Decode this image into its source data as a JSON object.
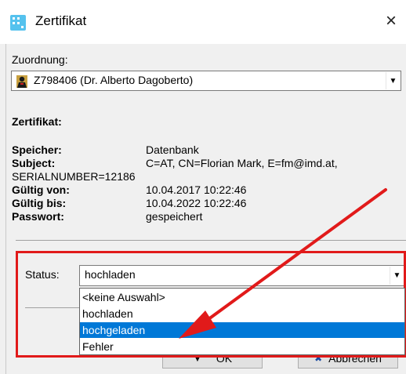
{
  "window": {
    "title": "Zertifikat",
    "close_symbol": "×"
  },
  "assignment": {
    "label": "Zuordnung:",
    "value": "Z798406 (Dr. Alberto Dagoberto)"
  },
  "certificate": {
    "heading": "Zertifikat:",
    "fields": {
      "speicher_label": "Speicher:",
      "speicher_value": "Datenbank",
      "subject_label": "Subject:",
      "subject_value": "C=AT, CN=Florian Mark, E=fm@imd.at,",
      "subject_cont": "SERIALNUMBER=12186",
      "gueltig_von_label": "Gültig von:",
      "gueltig_von_value": "10.04.2017 10:22:46",
      "gueltig_bis_label": "Gültig bis:",
      "gueltig_bis_value": "10.04.2022 10:22:46",
      "passwort_label": "Passwort:",
      "passwort_value": "gespeichert"
    }
  },
  "status": {
    "label": "Status:",
    "value": "hochladen",
    "options": [
      "<keine Auswahl>",
      "hochladen",
      "hochgeladen",
      "Fehler"
    ],
    "selected_index": 2
  },
  "buttons": {
    "ok_label": "OK",
    "cancel_label": "Abbrechen"
  },
  "colors": {
    "highlight": "#0078d7",
    "annotation": "#e11a1a"
  },
  "icons": {
    "app": "app-icon",
    "person": "person-icon",
    "close": "close-icon",
    "dropdown": "chevron-down-icon"
  }
}
